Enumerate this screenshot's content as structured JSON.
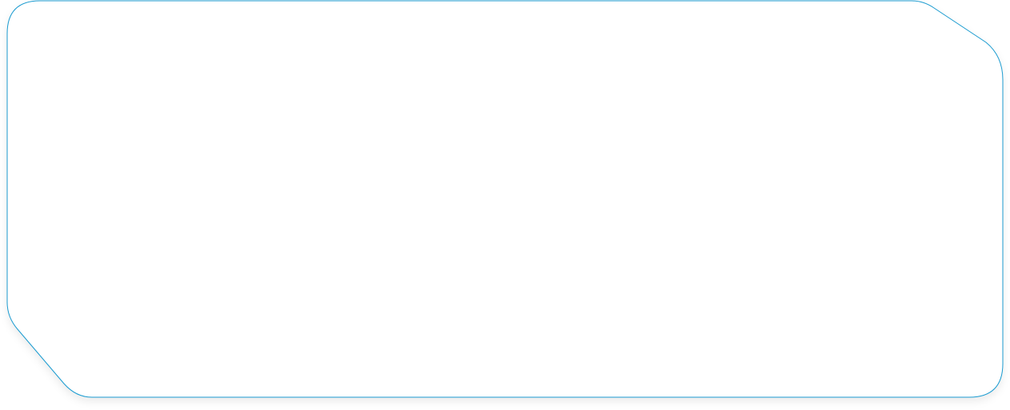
{
  "panel": {
    "stroke_color": "#1a9bd0",
    "fill_color": "#ffffff",
    "shadow_color": "#000000"
  }
}
